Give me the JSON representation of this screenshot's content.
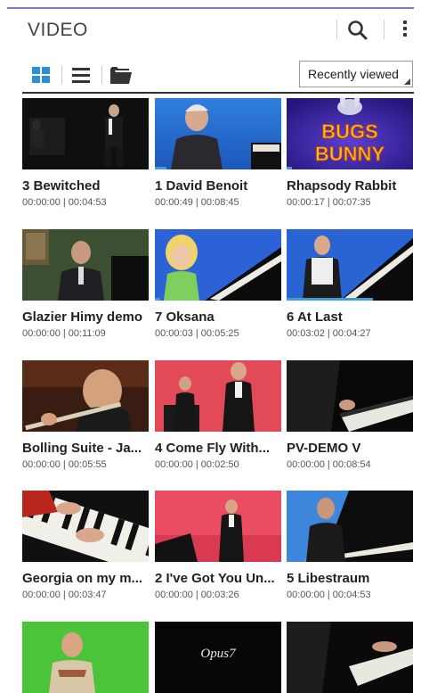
{
  "header": {
    "title": "VIDEO"
  },
  "icons": {
    "search": "search-icon",
    "more": "overflow-menu-icon",
    "grid": "grid-view-icon",
    "list": "list-view-icon",
    "folder": "folder-view-icon"
  },
  "sort": {
    "selected": "Recently viewed"
  },
  "colors": {
    "accent": "#3f9cd6",
    "header_line": "#7e76d9"
  },
  "videos": [
    {
      "title": "3 Bewitched",
      "time": "00:00:00 | 00:04:53",
      "progress": 0
    },
    {
      "title": "1 David Benoit",
      "time": "00:00:49 | 00:08:45",
      "progress": 0.09
    },
    {
      "title": "Rhapsody Rabbit",
      "time": "00:00:17 | 00:07:35",
      "progress": 0.04
    },
    {
      "title": "Glazier Himy demo",
      "time": "00:00:00 | 00:11:09",
      "progress": 0
    },
    {
      "title": "7 Oksana",
      "time": "00:00:03 | 00:05:25",
      "progress": 0.01
    },
    {
      "title": "6 At Last",
      "time": "00:03:02 | 00:04:27",
      "progress": 0.68
    },
    {
      "title": "Bolling Suite - Ja...",
      "time": "00:00:00 | 00:05:55",
      "progress": 0
    },
    {
      "title": "4 Come Fly With...",
      "time": "00:00:00 | 00:02:50",
      "progress": 0
    },
    {
      "title": "PV-DEMO V",
      "time": "00:00:00 | 00:08:54",
      "progress": 0
    },
    {
      "title": "Georgia on my m...",
      "time": "00:00:00 | 00:03:47",
      "progress": 0
    },
    {
      "title": "2 I've Got You Un...",
      "time": "00:00:00 | 00:03:26",
      "progress": 0
    },
    {
      "title": "5 Libestraum",
      "time": "00:00:00 | 00:04:53",
      "progress": 0
    },
    {
      "title": "",
      "time": "",
      "progress": 0
    },
    {
      "title": "",
      "time": "",
      "progress": 0
    },
    {
      "title": "",
      "time": "",
      "progress": 0
    }
  ],
  "thumb_text": {
    "bugs_line1": "BUGS",
    "bugs_line2": "BUNNY",
    "opus": "Opus7"
  }
}
